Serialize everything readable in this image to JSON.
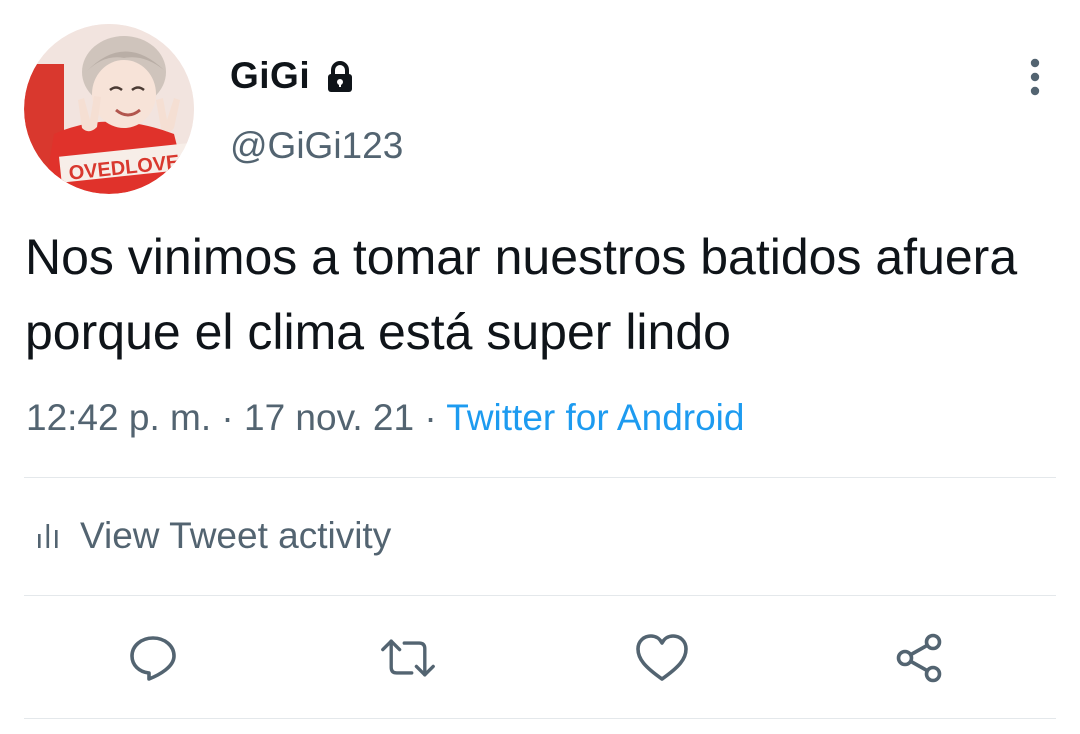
{
  "user": {
    "display_name": "GiGi",
    "handle": "@GiGi123",
    "avatar_shirt_text": "OVEDLOVE"
  },
  "tweet": {
    "text": "Nos vinimos a tomar nuestros batidos afuera porque el clima está super lindo",
    "time": "12:42 p. m.",
    "separator": " · ",
    "date": "17 nov. 21",
    "source": "Twitter for Android"
  },
  "activity": {
    "label": "View Tweet activity"
  },
  "actions": {
    "items": [
      {
        "name": "reply",
        "icon": "reply-icon"
      },
      {
        "name": "retweet",
        "icon": "retweet-icon"
      },
      {
        "name": "like",
        "icon": "heart-icon"
      },
      {
        "name": "share",
        "icon": "share-icon"
      }
    ]
  },
  "colors": {
    "text_primary": "#0f1419",
    "text_secondary": "#536471",
    "link": "#1d9bf0",
    "divider": "#e4e8eb"
  }
}
